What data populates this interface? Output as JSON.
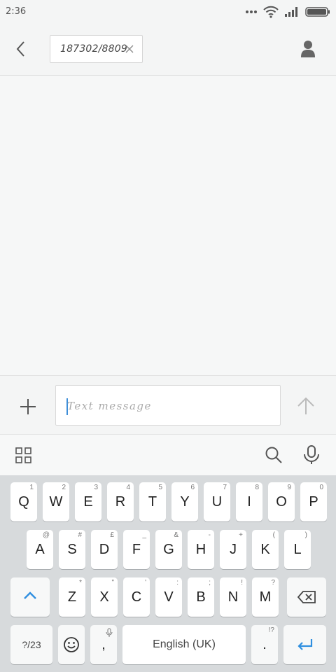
{
  "status_bar": {
    "time": "2:36"
  },
  "header": {
    "recipient": "187302/8809"
  },
  "compose": {
    "placeholder": "Text message"
  },
  "keyboard": {
    "row1": [
      {
        "key": "Q",
        "hint": "1"
      },
      {
        "key": "W",
        "hint": "2"
      },
      {
        "key": "E",
        "hint": "3"
      },
      {
        "key": "R",
        "hint": "4"
      },
      {
        "key": "T",
        "hint": "5"
      },
      {
        "key": "Y",
        "hint": "6"
      },
      {
        "key": "U",
        "hint": "7"
      },
      {
        "key": "I",
        "hint": "8"
      },
      {
        "key": "O",
        "hint": "9"
      },
      {
        "key": "P",
        "hint": "0"
      }
    ],
    "row2": [
      {
        "key": "A",
        "hint": "@"
      },
      {
        "key": "S",
        "hint": "#"
      },
      {
        "key": "D",
        "hint": "£"
      },
      {
        "key": "F",
        "hint": "_"
      },
      {
        "key": "G",
        "hint": "&"
      },
      {
        "key": "H",
        "hint": "-"
      },
      {
        "key": "J",
        "hint": "+"
      },
      {
        "key": "K",
        "hint": "("
      },
      {
        "key": "L",
        "hint": ")"
      }
    ],
    "row3": [
      {
        "key": "Z",
        "hint": "*"
      },
      {
        "key": "X",
        "hint": "\""
      },
      {
        "key": "C",
        "hint": "'"
      },
      {
        "key": "V",
        "hint": ":"
      },
      {
        "key": "B",
        "hint": ";"
      },
      {
        "key": "N",
        "hint": "!"
      },
      {
        "key": "M",
        "hint": "?"
      }
    ],
    "symbols_label": "?/23",
    "comma": ",",
    "space_label": "English (UK)",
    "period": ".",
    "period_hint": "!?"
  },
  "colors": {
    "accent": "#2f8fe0",
    "keyboard_bg": "#d7dadc"
  }
}
